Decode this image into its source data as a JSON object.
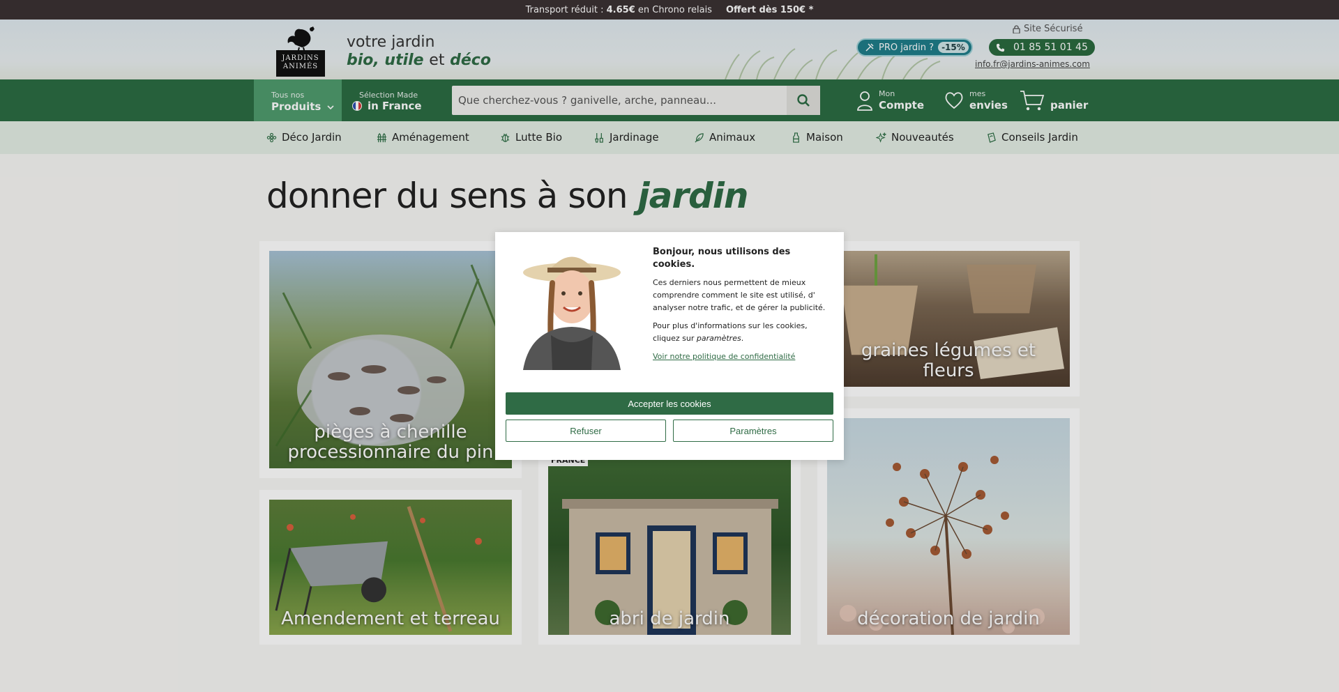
{
  "topbar": {
    "part1_prefix": "Transport réduit :",
    "part1_price": "4.65€",
    "part1_suffix": "en Chrono relais",
    "part2": "Offert dès 150€ *"
  },
  "header": {
    "logo_text_line1": "JARDINS",
    "logo_text_line2": "ANIMÉS",
    "tagline_line1": "votre jardin",
    "tagline_w1": "bio, utile",
    "tagline_et": "et",
    "tagline_w2": "déco",
    "secure": "Site Sécurisé",
    "pro_label": "PRO jardin ?",
    "pro_badge": "-15%",
    "phone": "01 85 51 01 45",
    "email": "info.fr@jardins-animes.com"
  },
  "nav": {
    "products_small": "Tous nos",
    "products_big": "Produits",
    "made_small": "Sélection Made",
    "made_big": "in France",
    "search_placeholder": "Que cherchez-vous ? ganivelle, arche, panneau...",
    "account_small": "Mon",
    "account_big": "Compte",
    "wish_small": "mes",
    "wish_big": "envies",
    "cart": "panier"
  },
  "categories": [
    "Déco Jardin",
    "Aménagement",
    "Lutte Bio",
    "Jardinage",
    "Animaux",
    "Maison",
    "Nouveautés",
    "Conseils Jardin"
  ],
  "main": {
    "headline_plain": "donner du sens à son",
    "headline_accent": "jardin",
    "cards": [
      "pièges à chenille processionnaire du pin",
      "graines légumes et fleurs",
      "Amendement et terreau",
      "abri de jardin",
      "décoration de jardin"
    ],
    "partial_badge": "FRANCE"
  },
  "cookie": {
    "title": "Bonjour, nous utilisons des cookies.",
    "p1": "Ces derniers nous permettent de mieux comprendre comment le site est utilisé, d' analyser notre trafic, et de gérer la publicité.",
    "p2_prefix": "Pour plus d'informations sur les cookies, cliquez sur",
    "p2_link": "paramètres",
    "p2_suffix": ".",
    "policy_link": "Voir notre politique de confidentialité",
    "accept": "Accepter les cookies",
    "refuse": "Refuser",
    "settings": "Paramètres"
  },
  "colors": {
    "brand_green": "#2b6c43",
    "topbar": "#3b3233",
    "pro_teal": "#1f7d8a"
  }
}
